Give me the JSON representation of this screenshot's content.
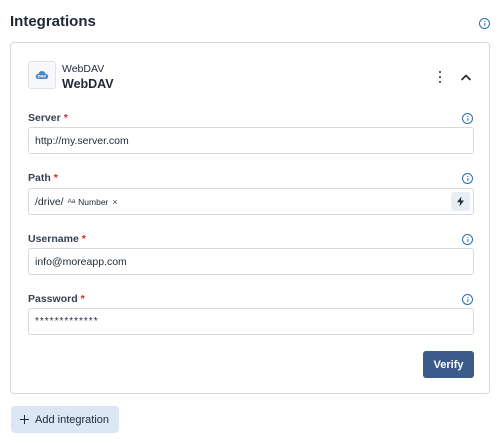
{
  "section": {
    "title": "Integrations"
  },
  "integration": {
    "subtitle": "WebDAV",
    "name": "WebDAV",
    "logo_icon": "cloud-dav-icon",
    "menu_icon": "kebab-menu-icon",
    "collapse_icon": "chevron-up-icon"
  },
  "fields": {
    "server": {
      "label": "Server",
      "required_mark": "*",
      "value": "http://my.server.com"
    },
    "path": {
      "label": "Path",
      "required_mark": "*",
      "value_prefix": "/drive/",
      "chip": {
        "type_icon": "Aa",
        "label": "Number",
        "remove": "×"
      },
      "action_icon": "lightning-icon"
    },
    "username": {
      "label": "Username",
      "required_mark": "*",
      "value": "info@moreapp.com"
    },
    "password": {
      "label": "Password",
      "required_mark": "*",
      "value": "*************"
    }
  },
  "buttons": {
    "verify": "Verify",
    "add_integration": "Add integration"
  },
  "colors": {
    "accent": "#3b5b8a",
    "info": "#2a6fb0",
    "required": "#dc2626",
    "add_button_bg": "#dbe7f5"
  }
}
